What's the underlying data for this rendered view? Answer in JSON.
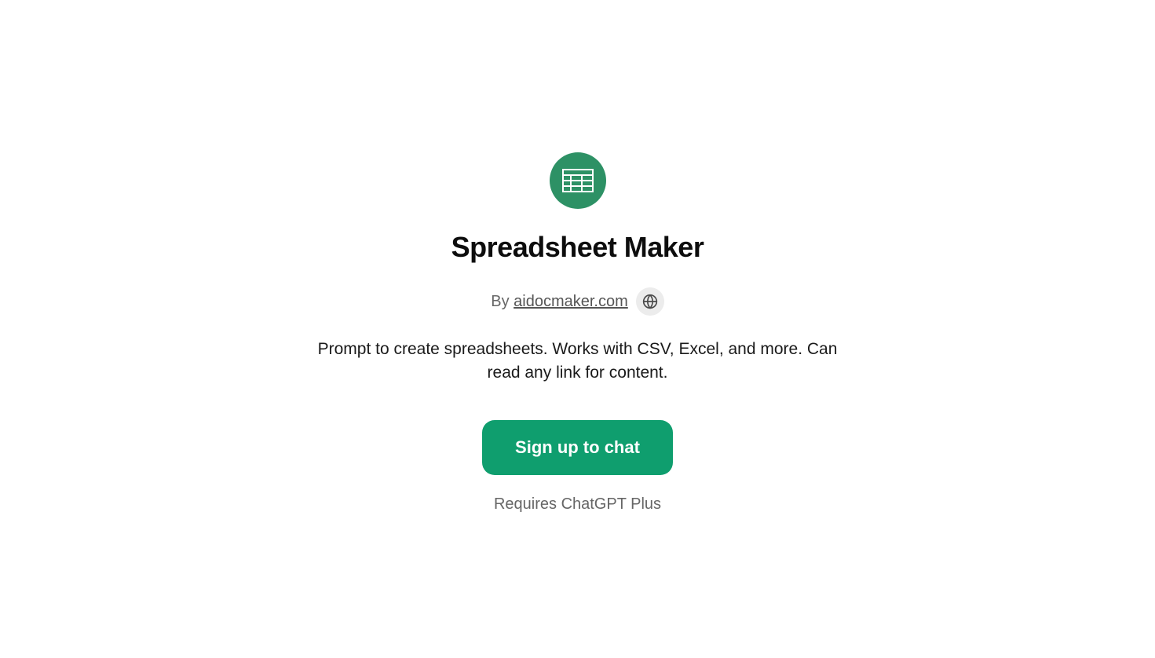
{
  "app": {
    "title": "Spreadsheet Maker",
    "author_prefix": "By ",
    "author_name": "aidocmaker.com",
    "description": "Prompt to create spreadsheets. Works with CSV, Excel, and more. Can read any link for content.",
    "signup_label": "Sign up to chat",
    "requirement": "Requires ChatGPT Plus"
  },
  "colors": {
    "icon_bg": "#2d9165",
    "button_bg": "#0f9e6e"
  }
}
